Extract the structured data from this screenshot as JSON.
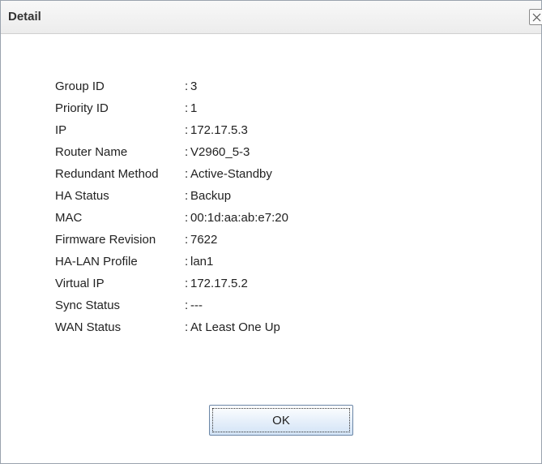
{
  "dialog": {
    "title": "Detail",
    "close_icon": "close-icon"
  },
  "details": [
    {
      "label": "Group ID",
      "value": "3"
    },
    {
      "label": "Priority ID",
      "value": "1"
    },
    {
      "label": "IP",
      "value": "172.17.5.3"
    },
    {
      "label": "Router Name",
      "value": "V2960_5-3"
    },
    {
      "label": "Redundant Method",
      "value": "Active-Standby"
    },
    {
      "label": "HA Status",
      "value": "Backup"
    },
    {
      "label": "MAC",
      "value": "00:1d:aa:ab:e7:20"
    },
    {
      "label": "Firmware Revision",
      "value": "7622"
    },
    {
      "label": "HA-LAN Profile",
      "value": "lan1"
    },
    {
      "label": "Virtual IP",
      "value": "172.17.5.2"
    },
    {
      "label": "Sync Status",
      "value": "---"
    },
    {
      "label": "WAN Status",
      "value": "At Least One Up"
    }
  ],
  "separator": ":",
  "buttons": {
    "ok_label": "OK"
  }
}
